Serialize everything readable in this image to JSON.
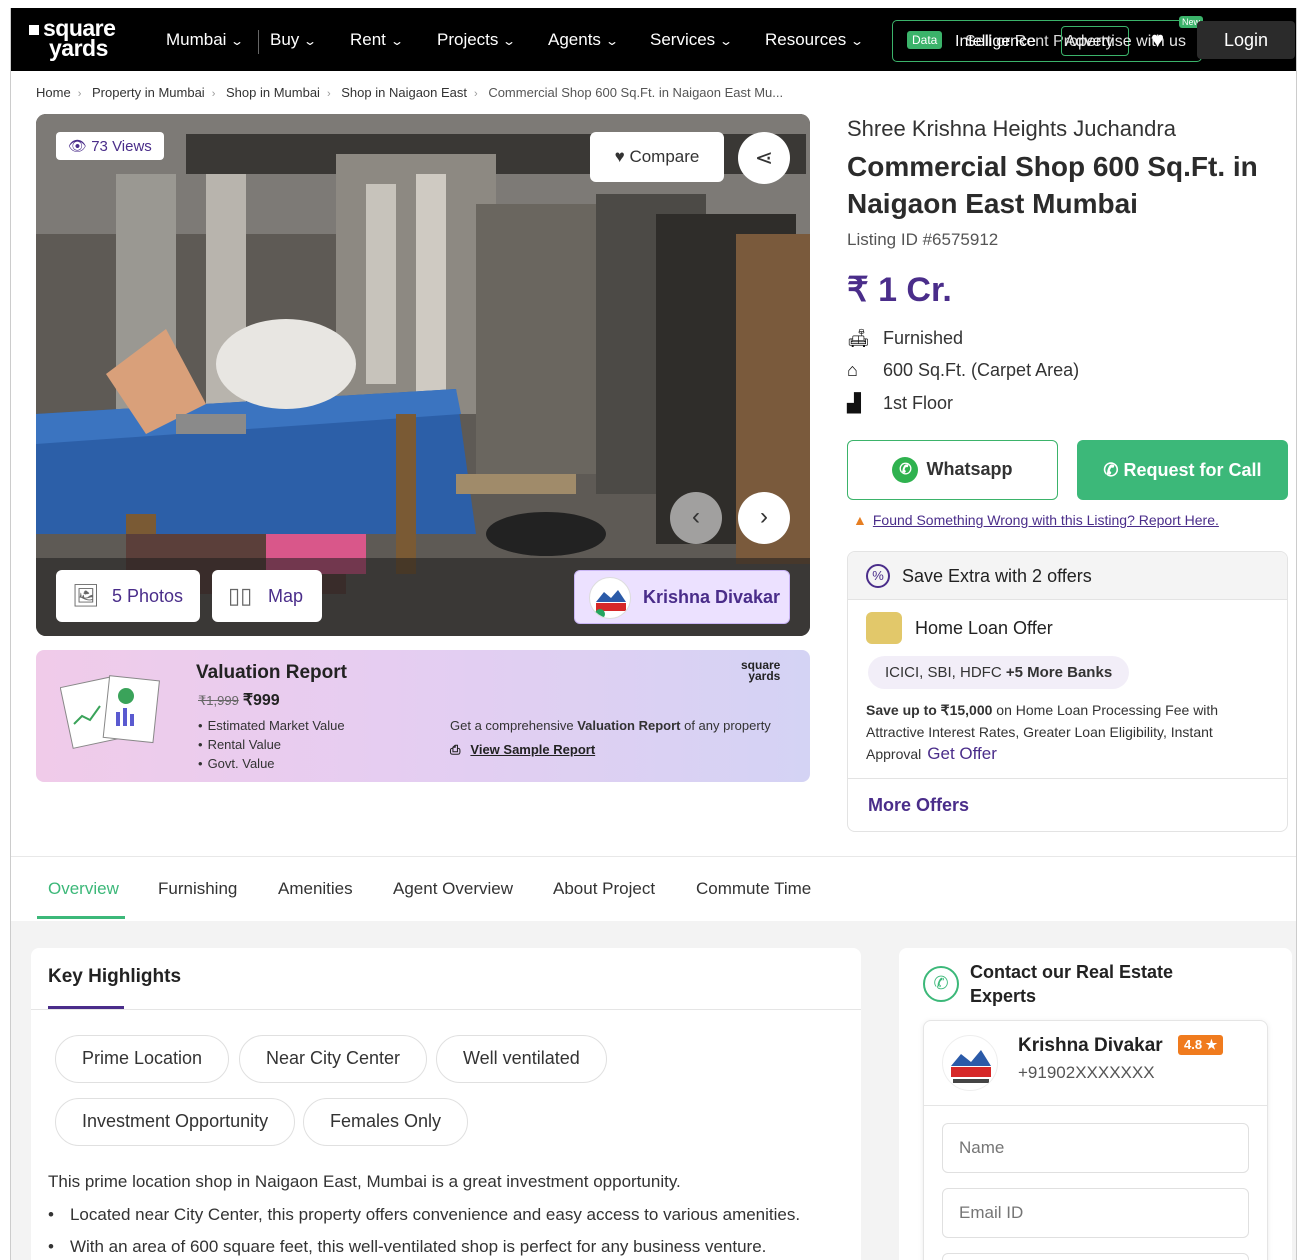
{
  "nav": {
    "logo_line1": "square",
    "logo_line2": "yards",
    "items": [
      "Mumbai",
      "Buy",
      "Rent",
      "Projects",
      "Agents",
      "Services",
      "Resources"
    ],
    "data_badge": "Data",
    "box_text1": "Intelligence",
    "box_text2": "Sell or Rent Property",
    "box_text3": "Advertise with us",
    "new_badge": "New",
    "login": "Login"
  },
  "breadcrumb": [
    "Home",
    "Property in Mumbai",
    "Shop in Mumbai",
    "Shop in Naigaon East",
    "Commercial Shop 600 Sq.Ft. in Naigaon East Mu..."
  ],
  "gallery": {
    "views": "73 Views",
    "compare": "Compare",
    "photos": "5 Photos",
    "map": "Map",
    "agent": "Krishna Divakar"
  },
  "valuation": {
    "title": "Valuation Report",
    "old_price": "₹1,999",
    "price": "₹999",
    "bullets": [
      "Estimated Market Value",
      "Rental Value",
      "Govt. Value"
    ],
    "desc_pre": "Get a comprehensive ",
    "desc_bold": "Valuation Report",
    "desc_post": " of any property",
    "link": "View Sample Report",
    "logo1": "square",
    "logo2": "yards"
  },
  "listing": {
    "project": "Shree Krishna Heights Juchandra",
    "title": "Commercial Shop 600 Sq.Ft. in Naigaon East Mumbai",
    "listing_id": "Listing ID #6575912",
    "price": "₹ 1 Cr.",
    "features": [
      {
        "icon": "sofa-icon",
        "text": "Furnished"
      },
      {
        "icon": "home-icon",
        "text": "600 Sq.Ft. (Carpet Area)"
      },
      {
        "icon": "stairs-icon",
        "text": "1st Floor"
      }
    ],
    "whatsapp": "Whatsapp",
    "request_call": "Request for Call",
    "report": "Found Something Wrong with this Listing? Report Here."
  },
  "offers": {
    "heading": "Save Extra with 2 offers",
    "offer_title": "Home Loan Offer",
    "banks": "ICICI, SBI, HDFC",
    "banks_more": "+5 More Banks",
    "text_bold": "Save up to ₹15,000",
    "text_rest": " on Home Loan Processing Fee with Attractive Interest Rates, Greater Loan Eligibility, Instant Approval",
    "get_offer": "Get Offer",
    "more": "More Offers"
  },
  "tabs": [
    "Overview",
    "Furnishing",
    "Amenities",
    "Agent Overview",
    "About Project",
    "Commute Time"
  ],
  "highlights": {
    "title": "Key Highlights",
    "chips": [
      "Prime Location",
      "Near City Center",
      "Well ventilated",
      "Investment Opportunity",
      "Females Only"
    ],
    "desc": "This prime location shop in Naigaon East, Mumbai is a great investment opportunity.",
    "bullets": [
      "Located near City Center, this property offers convenience and easy access to various amenities.",
      "With an area of 600 square feet, this well-ventilated shop is perfect for any business venture."
    ]
  },
  "contact": {
    "title": "Contact our Real Estate Experts",
    "agent_name": "Krishna Divakar",
    "rating": "4.8 ★",
    "phone": "+91902XXXXXXX",
    "name_placeholder": "Name",
    "email_placeholder": "Email ID"
  },
  "colors": {
    "brand_purple": "#4a2d8a",
    "accent_green": "#3cb879",
    "nav_bg": "#000000"
  }
}
